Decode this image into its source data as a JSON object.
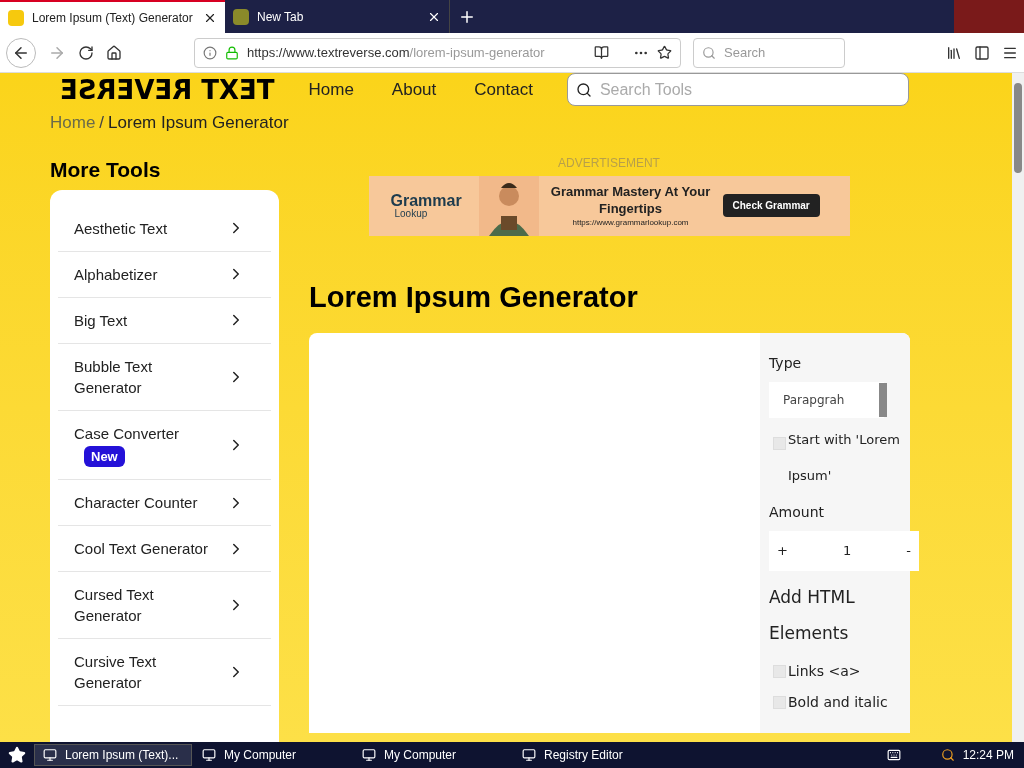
{
  "browser": {
    "tabs": [
      {
        "title": "Lorem Ipsum (Text) Generator",
        "selected": true
      },
      {
        "title": "New Tab",
        "selected": false
      }
    ],
    "url_host": "https://www.textreverse.com",
    "url_path": "/lorem-ipsum-generator",
    "search_placeholder": "Search"
  },
  "site": {
    "logo": "TEXT REVERSE",
    "nav": [
      "Home",
      "About",
      "Contact"
    ],
    "search_placeholder": "Search Tools"
  },
  "breadcrumb": {
    "home": "Home",
    "separator": "/",
    "current": "Lorem Ipsum Generator"
  },
  "sidebar": {
    "title": "More Tools",
    "items": [
      {
        "label": "Aesthetic Text"
      },
      {
        "label": "Alphabetizer"
      },
      {
        "label": "Big Text"
      },
      {
        "label": "Bubble Text Generator"
      },
      {
        "label": "Case Converter",
        "badge": "New"
      },
      {
        "label": "Character Counter"
      },
      {
        "label": "Cool Text Generator"
      },
      {
        "label": "Cursed Text Generator"
      },
      {
        "label": "Cursive Text Generator"
      }
    ]
  },
  "ad": {
    "label": "ADVERTISEMENT",
    "brand": "Grammar",
    "brand_sub": "Lookup",
    "headline": "Grammar Mastery At Your Fingertips",
    "url": "https://www.grammarlookup.com",
    "cta": "Check Grammar"
  },
  "page_title": "Lorem Ipsum Generator",
  "options": {
    "type_label": "Type",
    "type_value": "Parapgrah",
    "start_with": {
      "label": "Start with 'Lorem Ipsum'",
      "checked": false
    },
    "amount_label": "Amount",
    "plus": "+",
    "amount": "1",
    "minus": "-",
    "html_title": "Add HTML Elements",
    "html_options": [
      {
        "label": "Links <a>",
        "checked": false
      },
      {
        "label": "Bold and italic",
        "checked": false
      }
    ]
  },
  "taskbar": {
    "items": [
      {
        "label": "Lorem Ipsum (Text)...",
        "selected": true
      },
      {
        "label": "My Computer",
        "selected": false
      },
      {
        "label": "My Computer",
        "selected": false
      },
      {
        "label": "Registry Editor",
        "selected": false
      }
    ],
    "clock": "12:24 PM"
  }
}
